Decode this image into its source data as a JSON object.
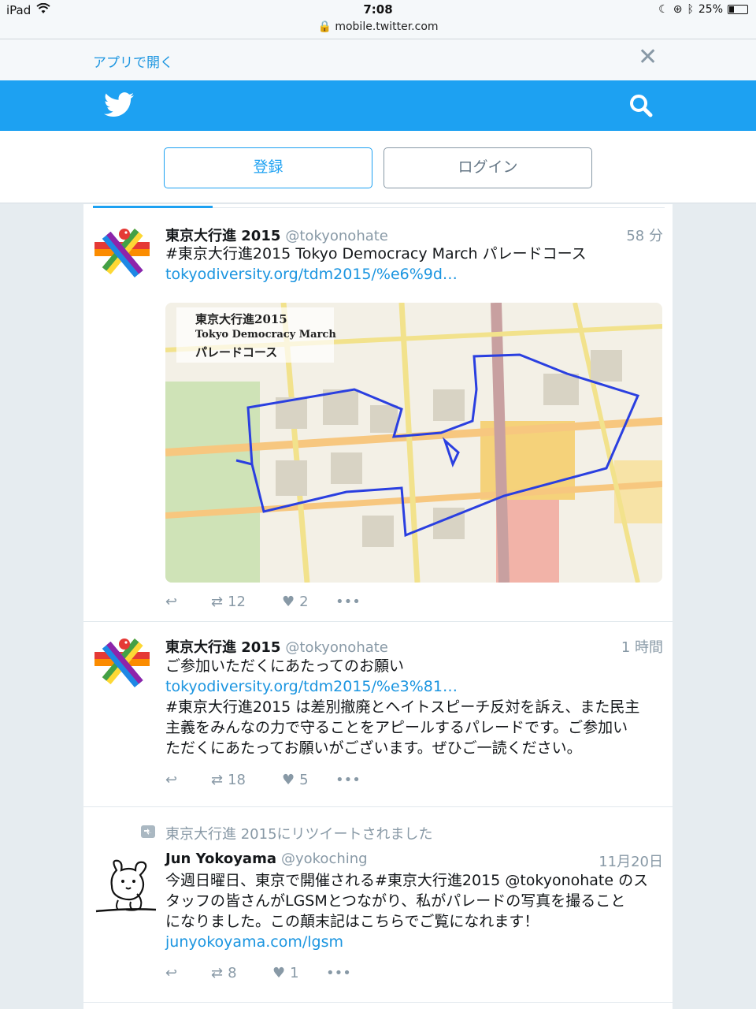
{
  "status_bar": {
    "device": "iPad",
    "time": "7:08",
    "url": "mobile.twitter.com",
    "battery": "25%",
    "battery_level": 0.25
  },
  "banner": {
    "open_in_app": "アプリで開く"
  },
  "auth": {
    "signup": "登録",
    "login": "ログイン"
  },
  "colors": {
    "brand": "#1da1f2",
    "link": "#1b95e0",
    "muted": "#8899a6"
  },
  "tweets": [
    {
      "name": "東京大行進 2015",
      "handle": "@tokyonohate",
      "time": "58 分",
      "text": "#東京大行進2015 Tokyo Democracy March パレードコース",
      "link": "tokyodiversity.org/tdm2015/%e6%9d…",
      "media": {
        "title_line1": "東京大行進2015",
        "title_line2": "Tokyo Democracy March",
        "title_line3": "パレードコース"
      },
      "retweets": "12",
      "likes": "2"
    },
    {
      "name": "東京大行進 2015",
      "handle": "@tokyonohate",
      "time": "1 時間",
      "text": "ご参加いただくにあたってのお願い",
      "link": "tokyodiversity.org/tdm2015/%e3%81…",
      "body_line1": "#東京大行進2015 は差別撤廃とヘイトスピーチ反対を訴え、また民主",
      "body_line2": "主義をみんなの力で守ることをアピールするパレードです。ご参加い",
      "body_line3": "ただくにあたってお願いがございます。ぜひご一読ください。",
      "retweets": "18",
      "likes": "5"
    },
    {
      "retweeted_by": "東京大行進 2015にリツイートされました",
      "name": "Jun Yokoyama",
      "handle": "@yokoching",
      "time": "11月20日",
      "body_line1": "今週日曜日、東京で開催される#東京大行進2015 @tokyonohate のス",
      "body_line2": "タッフの皆さんがLGSMとつながり、私がパレードの写真を撮ること",
      "body_line3": "になりました。この顛末記はこちらでご覧になれます！",
      "link": "junyokoyama.com/lgsm",
      "retweets": "8",
      "likes": "1"
    }
  ]
}
